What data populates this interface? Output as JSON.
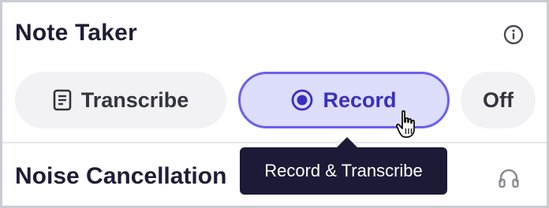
{
  "header": {
    "title": "Note Taker",
    "info_icon": "info-icon"
  },
  "mode_selector": {
    "options": [
      {
        "label": "Transcribe",
        "icon": "document-icon",
        "selected": false
      },
      {
        "label": "Record",
        "icon": "record-icon",
        "selected": true
      },
      {
        "label": "Off",
        "selected": false
      }
    ]
  },
  "tooltip": {
    "text": "Record & Transcribe"
  },
  "noise_section": {
    "title": "Noise Cancellation",
    "icon": "headphones-icon"
  },
  "colors": {
    "accent": "#6a5ff2",
    "selected_bg": "#ddddfc",
    "tooltip_bg": "#1c1a36",
    "title_text": "#1f1d36"
  }
}
